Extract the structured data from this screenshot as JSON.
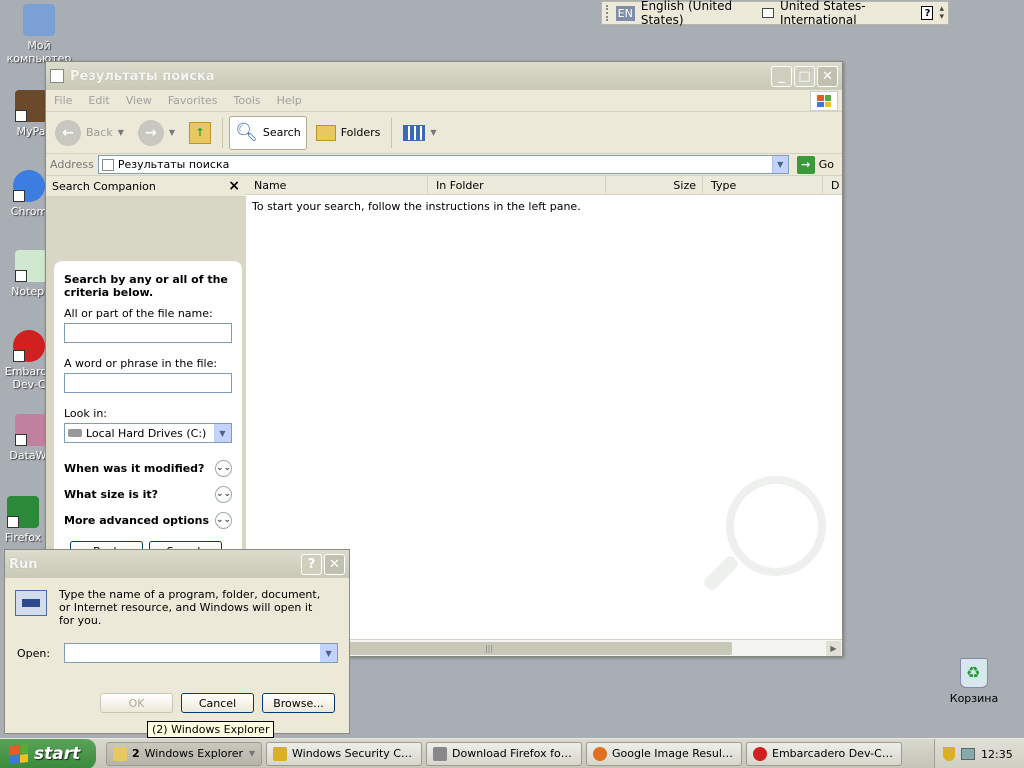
{
  "desktop": {
    "icons": [
      {
        "label": "Мой компьютер",
        "color": "#7aa0d6"
      },
      {
        "label": "MyPa",
        "color": "#6a4a2a"
      },
      {
        "label": "Chrom",
        "color": "#3b7de0"
      },
      {
        "label": "Notepa",
        "color": "#cfe8cf"
      },
      {
        "label": "Embarca Dev-C",
        "color": "#d02020"
      },
      {
        "label": "DataWa",
        "color": "#c080a0"
      },
      {
        "label": "Firefox",
        "color": "#2a8a3a"
      }
    ],
    "recycle_bin_label": "Корзина"
  },
  "langbar": {
    "code": "EN",
    "language": "English (United States)",
    "layout": "United States-International",
    "help": "?"
  },
  "explorer": {
    "title": "Результаты поиска",
    "menu": [
      "File",
      "Edit",
      "View",
      "Favorites",
      "Tools",
      "Help"
    ],
    "toolbar": {
      "back": "Back",
      "search": "Search",
      "folders": "Folders"
    },
    "address_label": "Address",
    "address_value": "Результаты поиска",
    "go_label": "Go",
    "companion": {
      "title": "Search Companion",
      "close": "×",
      "heading": "Search by any or all of the criteria below.",
      "file_name_label": "All or part of the file name:",
      "phrase_label": "A word or phrase in the file:",
      "look_in_label": "Look in:",
      "look_in_value": "Local Hard Drives (C:)",
      "expanders": [
        "When was it modified?",
        "What size is it?",
        "More advanced options"
      ],
      "back_button": "Back",
      "search_button": "Search"
    },
    "columns": [
      "Name",
      "In Folder",
      "Size",
      "Type",
      "D"
    ],
    "empty_message": "To start your search, follow the instructions in the left pane."
  },
  "run_dialog": {
    "title": "Run",
    "help": "?",
    "description": "Type the name of a program, folder, document, or Internet resource, and Windows will open it for you.",
    "open_label": "Open:",
    "open_value": "",
    "ok": "OK",
    "cancel": "Cancel",
    "browse": "Browse..."
  },
  "tooltip": "(2) Windows Explorer",
  "taskbar": {
    "start_label": "start",
    "tasks": [
      {
        "count": "2",
        "label": "Windows Explorer",
        "color": "#e8c860"
      },
      {
        "label": "Windows Security Ce...",
        "color": "#d8b020"
      },
      {
        "label": "Download Firefox for ...",
        "color": "#888"
      },
      {
        "label": "Google Image Result ...",
        "color": "#e07020"
      },
      {
        "label": "Embarcadero Dev-C++",
        "color": "#d02020"
      }
    ],
    "clock": "12:35"
  },
  "colors": {
    "start_green": "#3a8a3a",
    "desktop": "#a8aeb4",
    "input_border": "#7f9db9"
  }
}
